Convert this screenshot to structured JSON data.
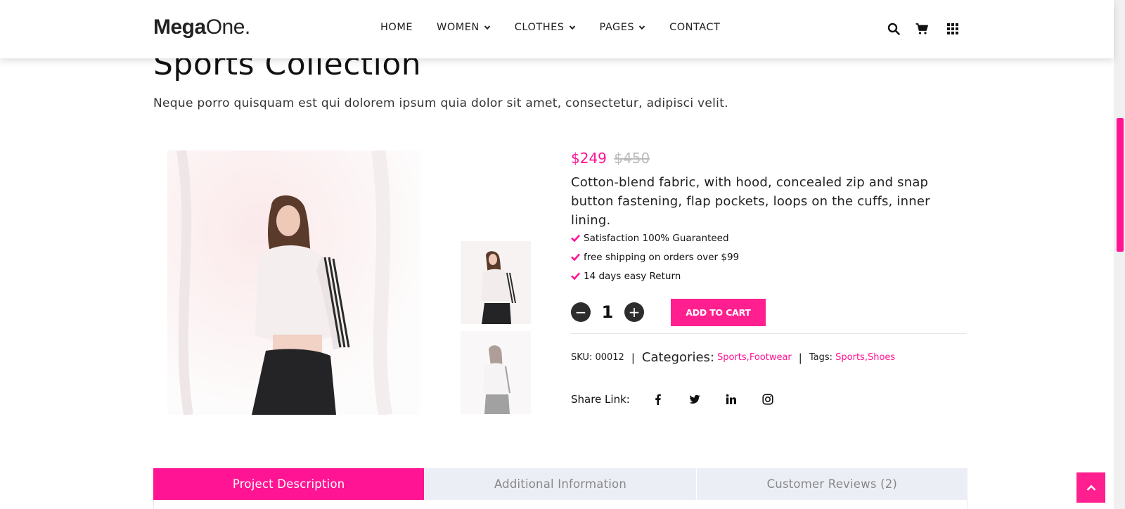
{
  "header": {
    "logo_bold": "Mega",
    "logo_light": "One.",
    "nav": [
      {
        "label": "HOME",
        "dropdown": false
      },
      {
        "label": "WOMEN",
        "dropdown": true
      },
      {
        "label": "CLOTHES",
        "dropdown": true
      },
      {
        "label": "PAGES",
        "dropdown": true
      },
      {
        "label": "CONTACT",
        "dropdown": false
      }
    ],
    "icons": [
      "search-icon",
      "cart-icon",
      "grid-menu-icon"
    ]
  },
  "page": {
    "title": "Sports Collection",
    "subtitle": "Neque porro quisquam est qui dolorem ipsum quia dolor sit amet, consectetur, adipisci velit."
  },
  "product": {
    "price": "$249",
    "old_price": "$450",
    "description": "Cotton-blend fabric, with hood, concealed zip and snap button fastening, flap pockets, loops on the cuffs, inner lining.",
    "features": [
      "Satisfaction 100% Guaranteed",
      "free shipping on orders over $99",
      "14 days easy Return"
    ],
    "quantity": "1",
    "minus_label": "−",
    "plus_label": "+",
    "add_to_cart": "ADD TO CART",
    "sku_label": "SKU:",
    "sku": "00012",
    "categories_label": "Categories:",
    "categories": [
      "Sports",
      "Footwear"
    ],
    "tags_label": "Tags:",
    "tags": [
      "Sports",
      "Shoes"
    ],
    "share_label": "Share Link:",
    "share_icons": [
      "facebook-icon",
      "twitter-icon",
      "linkedin-icon",
      "instagram-icon"
    ]
  },
  "tabs": [
    {
      "label": "Project Description",
      "active": true
    },
    {
      "label": "Additional Information",
      "active": false
    },
    {
      "label": "Customer Reviews (2)",
      "active": false
    }
  ],
  "colors": {
    "accent": "#ff1493",
    "dark": "#2d2d2d",
    "tab_inactive": "#ebeef5"
  }
}
